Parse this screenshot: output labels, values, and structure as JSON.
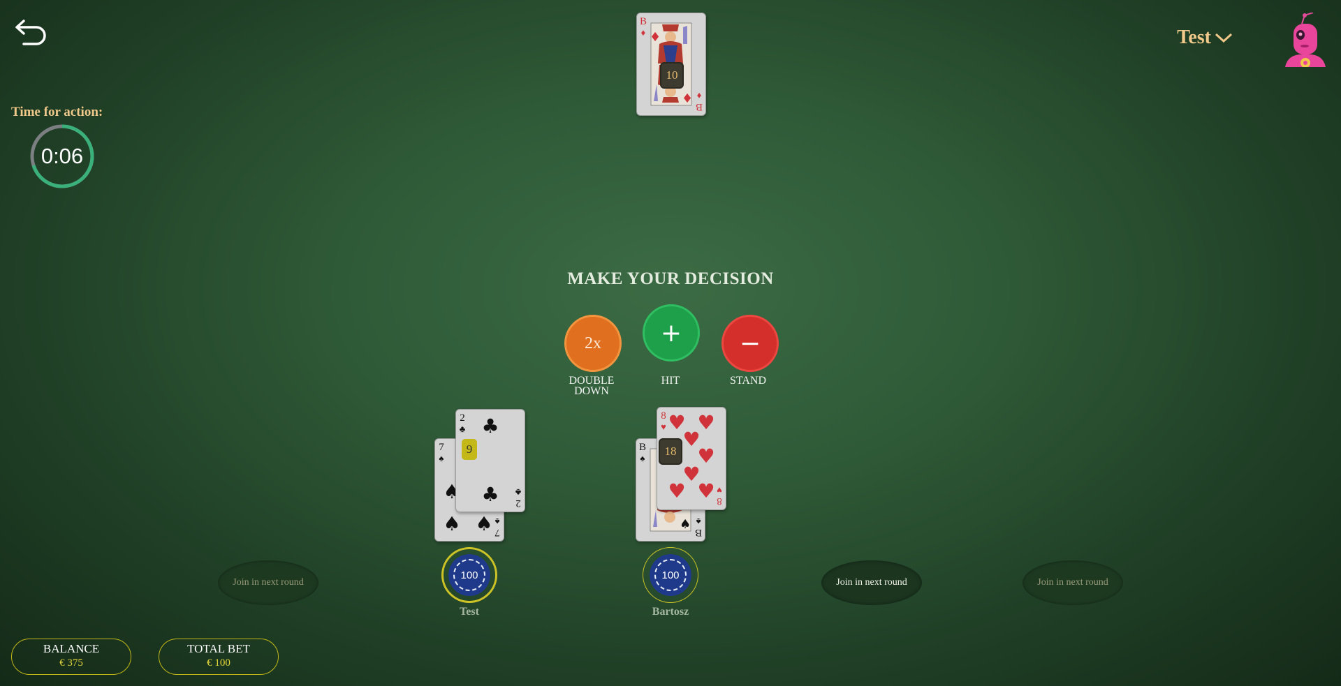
{
  "header": {
    "user_name": "Test"
  },
  "timer": {
    "label": "Time for action:",
    "value": "0:06",
    "remaining_fraction": 0.7
  },
  "dealer": {
    "card": {
      "rank": "B",
      "suit": "diamonds",
      "suit_symbol": "♦"
    },
    "score": "10"
  },
  "decision": {
    "title": "MAKE YOUR DECISION",
    "double_down": {
      "symbol": "2x",
      "label_line1": "DOUBLE",
      "label_line2": "DOWN"
    },
    "hit": {
      "symbol": "+",
      "label": "HIT"
    },
    "stand": {
      "symbol": "−",
      "label": "STAND"
    }
  },
  "colors": {
    "double_down": "#e07020",
    "hit": "#1ea04a",
    "stand": "#d42f2a",
    "accent_gold": "#f0c98a",
    "chip_ring": "#cdc327"
  },
  "players": [
    {
      "name": "Test",
      "bet": "100",
      "score": "9",
      "cards": [
        {
          "rank": "7",
          "suit_symbol": "♠"
        },
        {
          "rank": "2",
          "suit_symbol": "♣"
        }
      ]
    },
    {
      "name": "Bartosz",
      "bet": "100",
      "score": "18",
      "cards": [
        {
          "rank": "B",
          "suit_symbol": "♠"
        },
        {
          "rank": "8",
          "suit_symbol": "♥"
        }
      ]
    }
  ],
  "seats": [
    {
      "label": "Join in next round"
    },
    {
      "label": "Join in next round"
    },
    {
      "label": "Join in next round"
    }
  ],
  "footer": {
    "balance_label": "BALANCE",
    "balance_value": "€ 375",
    "total_bet_label": "TOTAL BET",
    "total_bet_value": "€ 100"
  }
}
